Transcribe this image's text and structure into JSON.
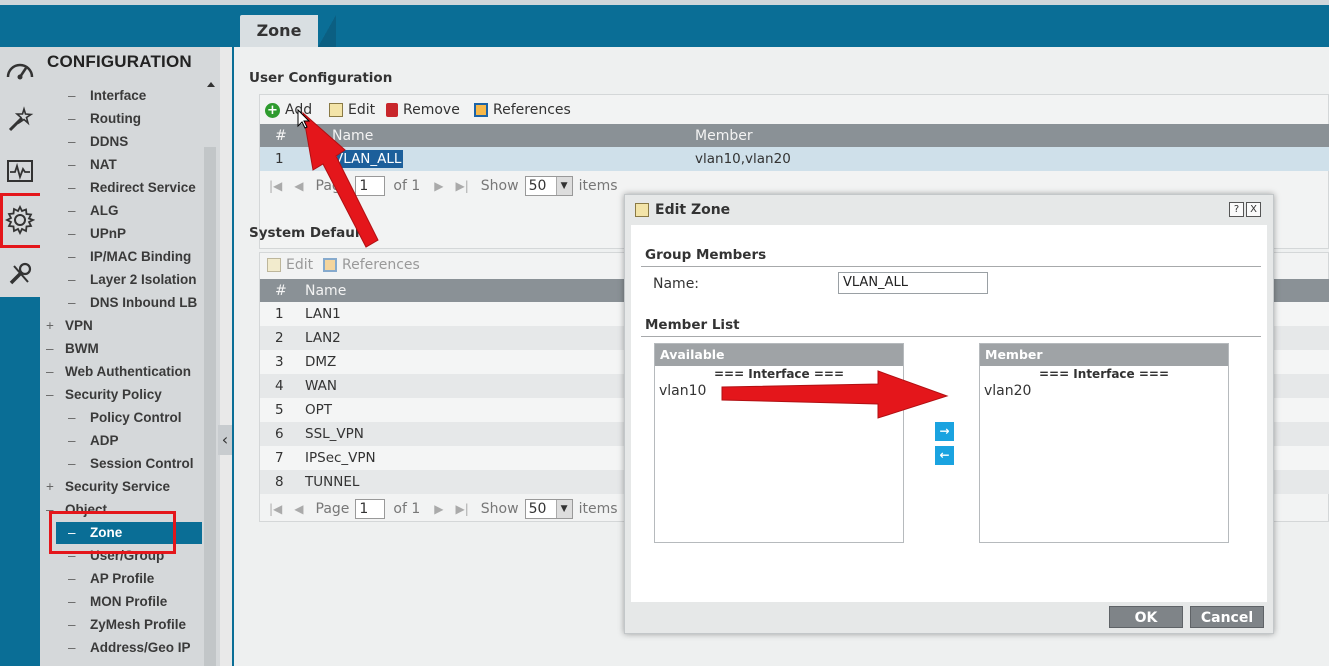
{
  "header": {
    "active_tab": "Zone"
  },
  "nav": {
    "title": "CONFIGURATION",
    "items": [
      {
        "label": "Interface",
        "pre": "–"
      },
      {
        "label": "Routing",
        "pre": "–"
      },
      {
        "label": "DDNS",
        "pre": "–"
      },
      {
        "label": "NAT",
        "pre": "–"
      },
      {
        "label": "Redirect Service",
        "pre": "–"
      },
      {
        "label": "ALG",
        "pre": "–"
      },
      {
        "label": "UPnP",
        "pre": "–"
      },
      {
        "label": "IP/MAC Binding",
        "pre": "–"
      },
      {
        "label": "Layer 2 Isolation",
        "pre": "–"
      },
      {
        "label": "DNS Inbound LB",
        "pre": "–"
      },
      {
        "label": "VPN",
        "pre": "+"
      },
      {
        "label": "BWM",
        "pre": "–"
      },
      {
        "label": "Web Authentication",
        "pre": "–"
      },
      {
        "label": "Security Policy",
        "pre": "–"
      },
      {
        "label": "Policy Control",
        "pre": "–"
      },
      {
        "label": "ADP",
        "pre": "–"
      },
      {
        "label": "Session Control",
        "pre": "–"
      },
      {
        "label": "Security Service",
        "pre": "+"
      },
      {
        "label": "Object",
        "pre": "–"
      },
      {
        "label": "Zone",
        "pre": "–"
      },
      {
        "label": "User/Group",
        "pre": "–"
      },
      {
        "label": "AP Profile",
        "pre": "–"
      },
      {
        "label": "MON Profile",
        "pre": "–"
      },
      {
        "label": "ZyMesh Profile",
        "pre": "–"
      },
      {
        "label": "Address/Geo IP",
        "pre": "–"
      }
    ]
  },
  "user_config": {
    "title": "User Configuration",
    "toolbar": {
      "add": "Add",
      "edit": "Edit",
      "remove": "Remove",
      "references": "References"
    },
    "columns": {
      "num": "#",
      "name": "Name",
      "member": "Member"
    },
    "rows": [
      {
        "num": "1",
        "name": "VLAN_ALL",
        "member": "vlan10,vlan20"
      }
    ],
    "pager": {
      "page_label": "Page",
      "page": "1",
      "of": "of 1",
      "show": "Show",
      "per_page": "50",
      "items": "items"
    }
  },
  "system_default": {
    "title": "System Default",
    "toolbar": {
      "edit": "Edit",
      "references": "References"
    },
    "columns": {
      "num": "#",
      "name": "Name"
    },
    "rows": [
      {
        "num": "1",
        "name": "LAN1"
      },
      {
        "num": "2",
        "name": "LAN2"
      },
      {
        "num": "3",
        "name": "DMZ"
      },
      {
        "num": "4",
        "name": "WAN"
      },
      {
        "num": "5",
        "name": "OPT"
      },
      {
        "num": "6",
        "name": "SSL_VPN"
      },
      {
        "num": "7",
        "name": "IPSec_VPN"
      },
      {
        "num": "8",
        "name": "TUNNEL"
      }
    ],
    "pager": {
      "page_label": "Page",
      "page": "1",
      "of": "of 1",
      "show": "Show",
      "per_page": "50",
      "items": "items"
    }
  },
  "dialog": {
    "title": "Edit Zone",
    "help": "?",
    "close": "X",
    "group_members": "Group Members",
    "name_label": "Name:",
    "name_value": "VLAN_ALL",
    "member_list": "Member List",
    "available": {
      "header": "Available",
      "group": "=== Interface ===",
      "items": [
        "vlan10"
      ]
    },
    "member": {
      "header": "Member",
      "group": "=== Interface ===",
      "items": [
        "vlan20"
      ]
    },
    "move_right": "→",
    "move_left": "←",
    "ok": "OK",
    "cancel": "Cancel"
  },
  "colors": {
    "brand": "#0a6e96",
    "annotation": "#e4161b",
    "accent": "#1aa3e0"
  }
}
